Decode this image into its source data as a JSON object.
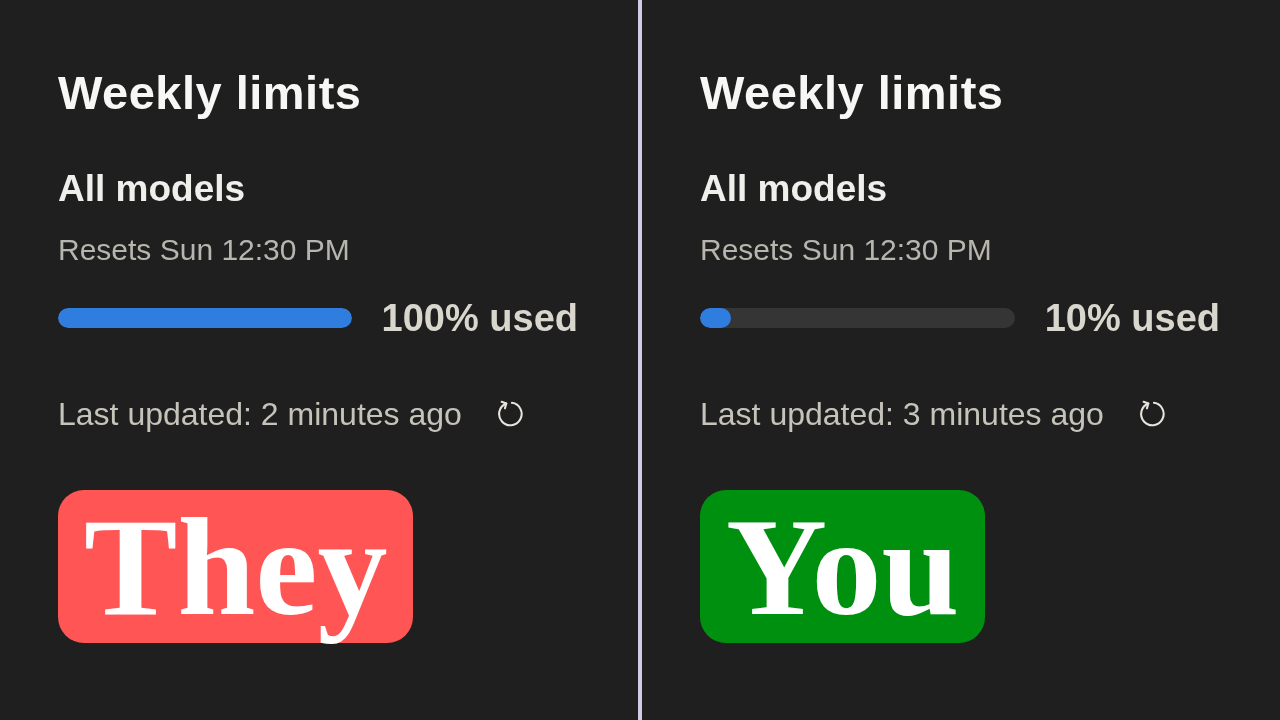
{
  "panels": [
    {
      "title": "Weekly limits",
      "section": "All models",
      "reset_note": "Resets Sun 12:30 PM",
      "usage": {
        "level": 1,
        "label": "100% used"
      },
      "last_updated": "Last updated: 2 minutes ago",
      "badge": {
        "label": "They",
        "color": "#ff5555"
      }
    },
    {
      "title": "Weekly limits",
      "section": "All models",
      "reset_note": "Resets Sun 12:30 PM",
      "usage": {
        "level": 0.1,
        "label": "10% used"
      },
      "last_updated": "Last updated: 3 minutes ago",
      "badge": {
        "label": "You",
        "color": "#009010"
      }
    }
  ]
}
